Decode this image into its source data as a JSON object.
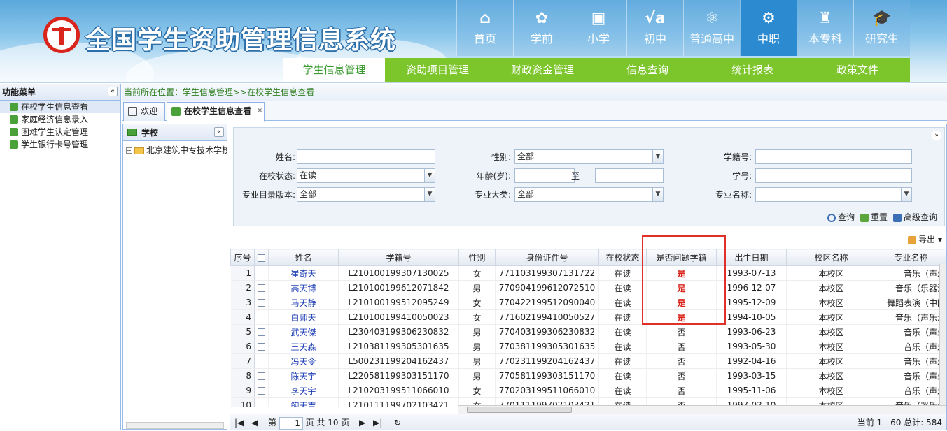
{
  "header": {
    "title": "全国学生资助管理信息系统",
    "topnav": [
      {
        "label": "首页",
        "icon": "home-icon",
        "glyph": "⌂"
      },
      {
        "label": "学前",
        "icon": "flower-icon",
        "glyph": "✿"
      },
      {
        "label": "小学",
        "icon": "board-icon",
        "glyph": "▣"
      },
      {
        "label": "初中",
        "icon": "sqrt-icon",
        "glyph": "√a"
      },
      {
        "label": "普通高中",
        "icon": "atom-icon",
        "glyph": "⚛"
      },
      {
        "label": "中职",
        "icon": "gears-icon",
        "glyph": "⚙"
      },
      {
        "label": "本专科",
        "icon": "building-icon",
        "glyph": "♜"
      },
      {
        "label": "研究生",
        "icon": "mortarboard-icon",
        "glyph": "🎓"
      }
    ],
    "subnav": [
      "学生信息管理",
      "资助项目管理",
      "财政资金管理",
      "信息查询",
      "统计报表",
      "政策文件"
    ]
  },
  "sidebar": {
    "title": "功能菜单",
    "items": [
      "在校学生信息查看",
      "家庭经济信息录入",
      "困难学生认定管理",
      "学生银行卡号管理"
    ]
  },
  "breadcrumb": "当前所在位置：学生信息管理>>在校学生信息查看",
  "tabs": [
    "欢迎",
    "在校学生信息查看"
  ],
  "school_panel": {
    "title": "学校",
    "node": "北京建筑中专技术学校"
  },
  "search": {
    "name_label": "姓名:",
    "name_value": "",
    "gender_label": "性别:",
    "gender_value": "全部",
    "xjh_label": "学籍号:",
    "xjh_value": "",
    "status_label": "在校状态:",
    "status_value": "在读",
    "age_label": "年龄(岁):",
    "age_to": "至",
    "xh_label": "学号:",
    "version_label": "专业目录版本:",
    "version_value": "全部",
    "category_label": "专业大类:",
    "category_value": "全部",
    "major_label": "专业名称:",
    "major_value": "",
    "query": "查询",
    "reset": "重置",
    "advanced": "高级查询",
    "export": "导出"
  },
  "grid": {
    "columns": [
      "序号",
      "",
      "姓名",
      "学籍号",
      "性别",
      "身份证件号",
      "在校状态",
      "是否问题学籍",
      "出生日期",
      "校区名称",
      "专业名称"
    ],
    "rows": [
      [
        "1",
        "",
        "崔奇天",
        "L210100199307130025",
        "女",
        "771103199307131722",
        "在读",
        "是",
        "1993-07-13",
        "本校区",
        "音乐（声乐"
      ],
      [
        "2",
        "",
        "高天博",
        "L210100199612071842",
        "男",
        "770904199612072510",
        "在读",
        "是",
        "1996-12-07",
        "本校区",
        "音乐（乐器演"
      ],
      [
        "3",
        "",
        "马天静",
        "L210100199512095249",
        "女",
        "770422199512090040",
        "在读",
        "是",
        "1995-12-09",
        "本校区",
        "舞蹈表演（中国"
      ],
      [
        "4",
        "",
        "白师天",
        "L210100199410050023",
        "女",
        "771602199410050527",
        "在读",
        "是",
        "1994-10-05",
        "本校区",
        "音乐（声乐演"
      ],
      [
        "5",
        "",
        "武天傑",
        "L230403199306230832",
        "男",
        "770403199306230832",
        "在读",
        "否",
        "1993-06-23",
        "本校区",
        "音乐（声乐"
      ],
      [
        "6",
        "",
        "王天森",
        "L210381199305301635",
        "男",
        "770381199305301635",
        "在读",
        "否",
        "1993-05-30",
        "本校区",
        "音乐（声乐"
      ],
      [
        "7",
        "",
        "冯天令",
        "L500231199204162437",
        "男",
        "770231199204162437",
        "在读",
        "否",
        "1992-04-16",
        "本校区",
        "音乐（声乐"
      ],
      [
        "8",
        "",
        "陈天宇",
        "L220581199303151170",
        "男",
        "770581199303151170",
        "在读",
        "否",
        "1993-03-15",
        "本校区",
        "音乐（声乐"
      ],
      [
        "9",
        "",
        "李天宇",
        "L210203199511066010",
        "女",
        "770203199511066010",
        "在读",
        "否",
        "1995-11-06",
        "本校区",
        "音乐（声乐"
      ],
      [
        "10",
        "",
        "鲍天吉",
        "L210111199702103421",
        "女",
        "770111199702103421",
        "在读",
        "否",
        "1997-02-10",
        "本校区",
        "音乐（器乐演"
      ]
    ]
  },
  "pager": {
    "page_pre": "第",
    "page": "1",
    "page_post": "页 共 10 页",
    "summary": "当前 1 - 60 总计: 584"
  },
  "colors": {
    "accent_green": "#7cc52a",
    "active_blue": "#2b8ad0",
    "problem_red": "#d9251c"
  }
}
